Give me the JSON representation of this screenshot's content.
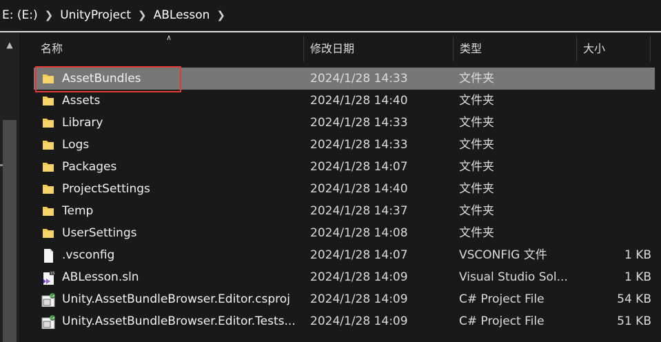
{
  "breadcrumb": {
    "items": [
      "E: (E:)",
      "UnityProject",
      "ABLesson"
    ]
  },
  "columns": {
    "name": "名称",
    "date": "修改日期",
    "type": "类型",
    "size": "大小"
  },
  "files": [
    {
      "name": "AssetBundles",
      "date": "2024/1/28 14:33",
      "type": "文件夹",
      "size": "",
      "icon": "folder-icon"
    },
    {
      "name": "Assets",
      "date": "2024/1/28 14:40",
      "type": "文件夹",
      "size": "",
      "icon": "folder-icon"
    },
    {
      "name": "Library",
      "date": "2024/1/28 14:33",
      "type": "文件夹",
      "size": "",
      "icon": "folder-icon"
    },
    {
      "name": "Logs",
      "date": "2024/1/28 14:33",
      "type": "文件夹",
      "size": "",
      "icon": "folder-icon"
    },
    {
      "name": "Packages",
      "date": "2024/1/28 14:07",
      "type": "文件夹",
      "size": "",
      "icon": "folder-icon"
    },
    {
      "name": "ProjectSettings",
      "date": "2024/1/28 14:40",
      "type": "文件夹",
      "size": "",
      "icon": "folder-icon"
    },
    {
      "name": "Temp",
      "date": "2024/1/28 14:37",
      "type": "文件夹",
      "size": "",
      "icon": "folder-icon"
    },
    {
      "name": "UserSettings",
      "date": "2024/1/28 14:08",
      "type": "文件夹",
      "size": "",
      "icon": "folder-icon"
    },
    {
      "name": ".vsconfig",
      "date": "2024/1/28 14:07",
      "type": "VSCONFIG 文件",
      "size": "1 KB",
      "icon": "file-icon"
    },
    {
      "name": "ABLesson.sln",
      "date": "2024/1/28 14:09",
      "type": "Visual Studio Sol...",
      "size": "1 KB",
      "icon": "visual-studio-solution-icon"
    },
    {
      "name": "Unity.AssetBundleBrowser.Editor.csproj",
      "date": "2024/1/28 14:09",
      "type": "C# Project File",
      "size": "54 KB",
      "icon": "csharp-project-icon"
    },
    {
      "name": "Unity.AssetBundleBrowser.Editor.Tests...",
      "date": "2024/1/28 14:09",
      "type": "C# Project File",
      "size": "51 KB",
      "icon": "csharp-project-icon"
    }
  ],
  "vs_badge": "15",
  "csharp_badge": "C#",
  "colors": {
    "background": "#191919",
    "selected_row": "#777777",
    "highlight_box": "#e53935",
    "folder": "#f2c94c"
  }
}
